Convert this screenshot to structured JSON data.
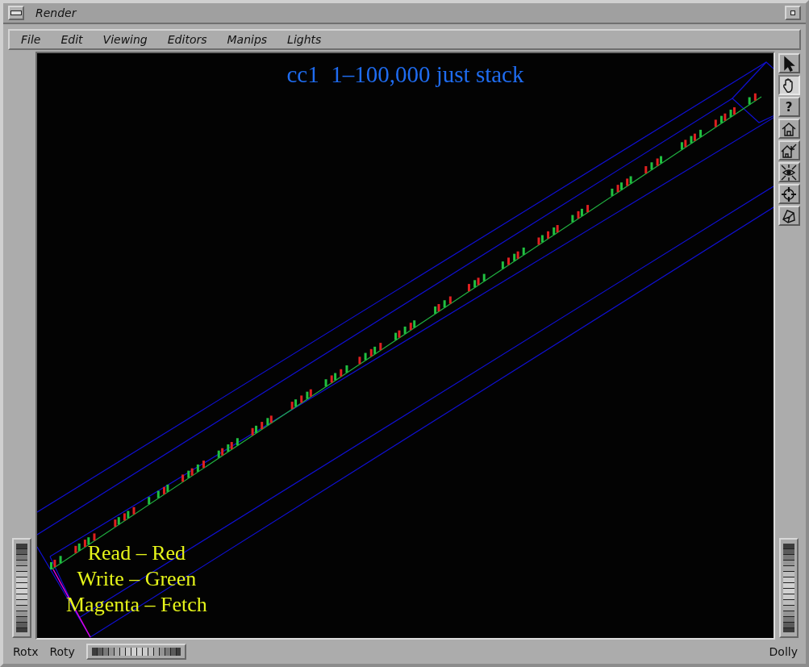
{
  "window": {
    "title": "Render"
  },
  "menu": [
    "File",
    "Edit",
    "Viewing",
    "Editors",
    "Manips",
    "Lights"
  ],
  "viewport": {
    "title": "cc1  1–100,000 just stack",
    "legend": [
      "Read – Red",
      "Write – Green",
      "Magenta – Fetch"
    ]
  },
  "tools": [
    {
      "kind": "pointer",
      "selected": false
    },
    {
      "kind": "hand",
      "selected": true
    },
    {
      "kind": "text",
      "label": "?",
      "selected": false
    },
    {
      "kind": "home",
      "selected": false
    },
    {
      "kind": "set-home",
      "selected": false
    },
    {
      "kind": "view-all",
      "selected": false
    },
    {
      "kind": "seek",
      "selected": false
    },
    {
      "kind": "camera",
      "selected": false
    }
  ],
  "bottom": {
    "left_labels": [
      "Rotx",
      "Roty"
    ],
    "right_label": "Dolly"
  }
}
